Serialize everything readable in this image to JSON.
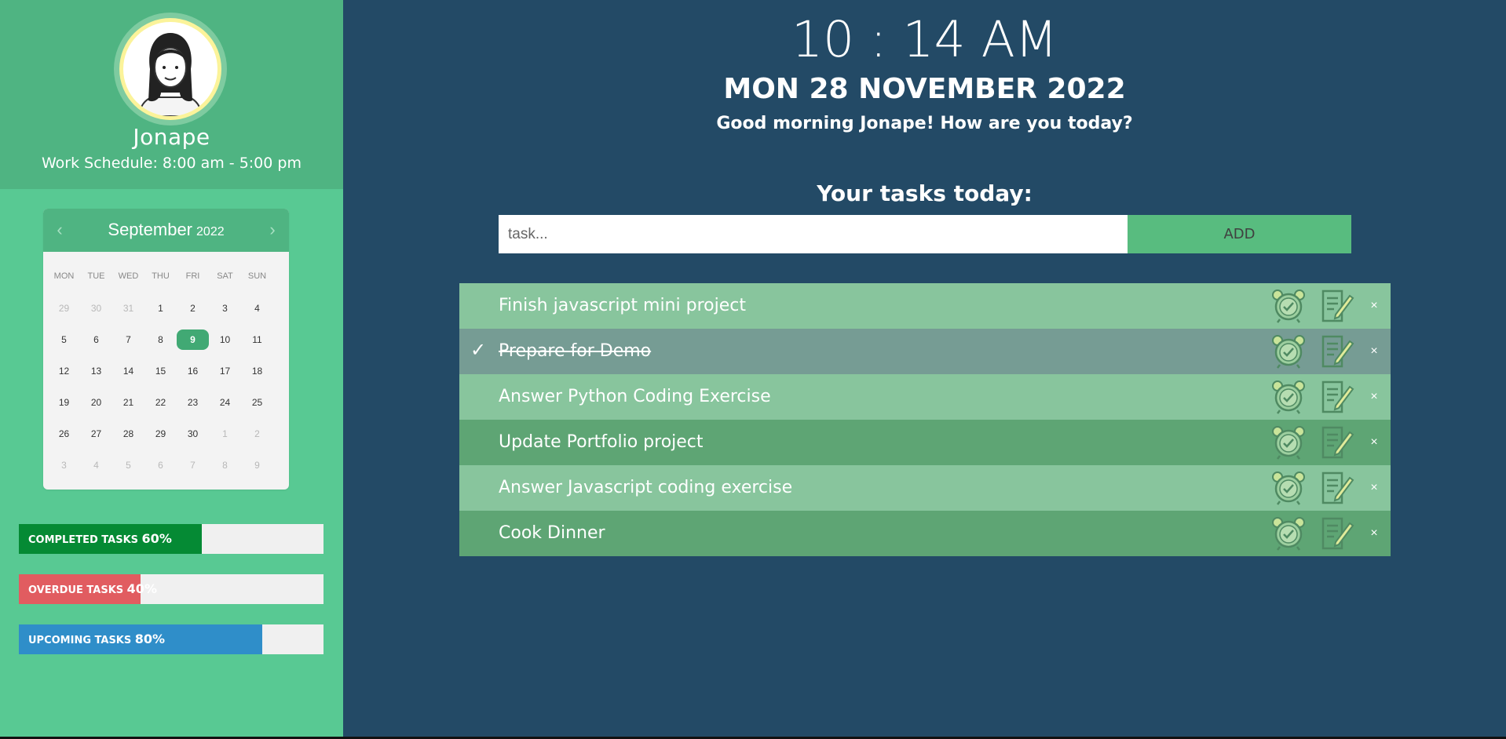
{
  "profile": {
    "name": "Jonape",
    "schedule": "Work Schedule: 8:00 am - 5:00 pm"
  },
  "calendar": {
    "month": "September",
    "year": "2022",
    "prev_label": "‹",
    "next_label": "›",
    "weekdays": [
      "MON",
      "TUE",
      "WED",
      "THU",
      "FRI",
      "SAT",
      "SUN"
    ],
    "weeks": [
      [
        "29",
        "30",
        "31",
        "1",
        "2",
        "3",
        "4"
      ],
      [
        "5",
        "6",
        "7",
        "8",
        "9",
        "10",
        "11"
      ],
      [
        "12",
        "13",
        "14",
        "15",
        "16",
        "17",
        "18"
      ],
      [
        "19",
        "20",
        "21",
        "22",
        "23",
        "24",
        "25"
      ],
      [
        "26",
        "27",
        "28",
        "29",
        "30",
        "1",
        "2"
      ],
      [
        "3",
        "4",
        "5",
        "6",
        "7",
        "8",
        "9"
      ]
    ],
    "selected_day": "9"
  },
  "stats": [
    {
      "label": "COMPLETED TASKS",
      "pct_text": "60%",
      "value": 0.6,
      "color": "#058a34"
    },
    {
      "label": "OVERDUE TASKS",
      "pct_text": "40%",
      "value": 0.4,
      "color": "#e15c60"
    },
    {
      "label": "UPCOMING TASKS",
      "pct_text": "80%",
      "value": 0.8,
      "color": "#2f8ec9"
    }
  ],
  "header": {
    "time": "10 : 14 AM",
    "date": "MON  28 NOVEMBER 2022",
    "greeting": "Good morning  Jonape! How are you today?"
  },
  "tasks_section": {
    "title": "Your tasks today:",
    "input_placeholder": "task...",
    "input_value": "",
    "add_label": "ADD"
  },
  "tasks": [
    {
      "text": "Finish javascript mini project",
      "done": false,
      "style": "light"
    },
    {
      "text": "Prepare for Demo",
      "done": true,
      "style": "done"
    },
    {
      "text": "Answer Python Coding Exercise",
      "done": false,
      "style": "light"
    },
    {
      "text": "Update Portfolio project",
      "done": false,
      "style": "dark"
    },
    {
      "text": "Answer Javascript coding exercise",
      "done": false,
      "style": "light"
    },
    {
      "text": "Cook Dinner",
      "done": false,
      "style": "dark"
    }
  ],
  "icons": {
    "check": "check-icon",
    "alarm": "alarm-clock-icon",
    "edit": "edit-note-icon",
    "close": "close-icon",
    "close_glyph": "×",
    "check_glyph": "✓"
  }
}
